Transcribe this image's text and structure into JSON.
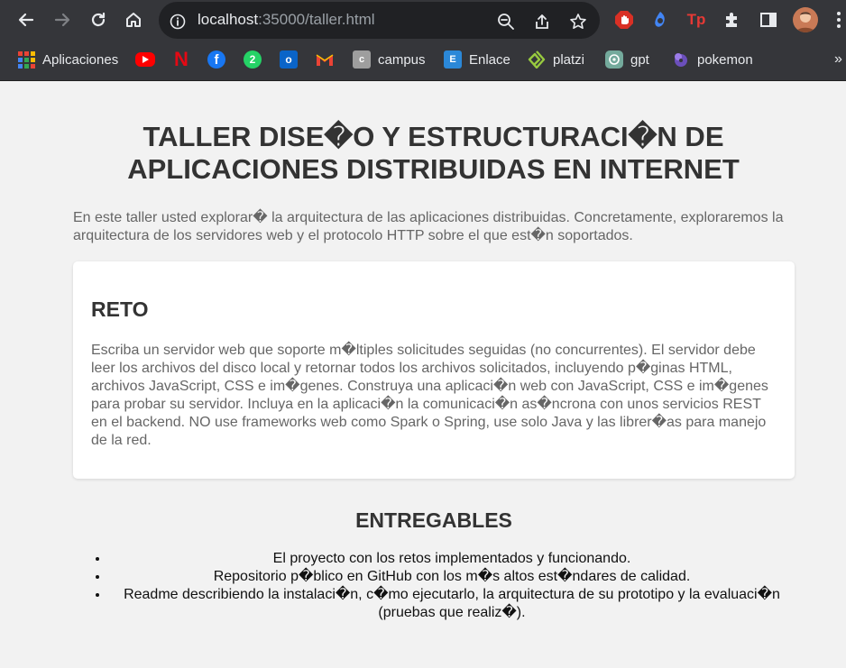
{
  "browser": {
    "url_host": "localhost",
    "url_path": ":35000/taller.html",
    "bookmarks": [
      {
        "label": "Aplicaciones",
        "icon": "apps-grid-icon"
      },
      {
        "label": "",
        "icon": "youtube-icon"
      },
      {
        "label": "",
        "icon": "netflix-icon"
      },
      {
        "label": "",
        "icon": "facebook-icon"
      },
      {
        "label": "",
        "icon": "whatsapp-icon"
      },
      {
        "label": "",
        "icon": "outlook-icon"
      },
      {
        "label": "",
        "icon": "gmail-icon"
      },
      {
        "label": "campus",
        "icon": "campus-icon"
      },
      {
        "label": "Enlace",
        "icon": "enlace-icon"
      },
      {
        "label": "platzi",
        "icon": "platzi-icon"
      },
      {
        "label": "gpt",
        "icon": "openai-icon"
      },
      {
        "label": "pokemon",
        "icon": "pokemon-icon"
      }
    ],
    "overflow_label": "»"
  },
  "page": {
    "title": "TALLER DISE�O Y ESTRUCTURACI�N DE APLICACIONES DISTRIBUIDAS EN INTERNET",
    "intro": "En este taller usted explorar� la arquitectura de las aplicaciones distribuidas. Concretamente, exploraremos la arquitectura de los servidores web y el protocolo HTTP sobre el que est�n soportados.",
    "reto_title": "RETO",
    "reto_text": "Escriba un servidor web que soporte m�ltiples solicitudes seguidas (no concurrentes). El servidor debe leer los archivos del disco local y retornar todos los archivos solicitados, incluyendo p�ginas HTML, archivos JavaScript, CSS e im�genes. Construya una aplicaci�n web con JavaScript, CSS e im�genes para probar su servidor. Incluya en la aplicaci�n la comunicaci�n as�ncrona con unos servicios REST en el backend. NO use frameworks web como Spark o Spring, use solo Java y las librer�as para manejo de la red.",
    "entregables_title": "ENTREGABLES",
    "entregables": [
      "El proyecto con los retos implementados y funcionando.",
      "Repositorio p�blico en GitHub con los m�s altos est�ndares de calidad.",
      "Readme describiendo la instalaci�n, c�mo ejecutarlo, la arquitectura de su prototipo y la evaluaci�n (pruebas que realiz�)."
    ]
  }
}
